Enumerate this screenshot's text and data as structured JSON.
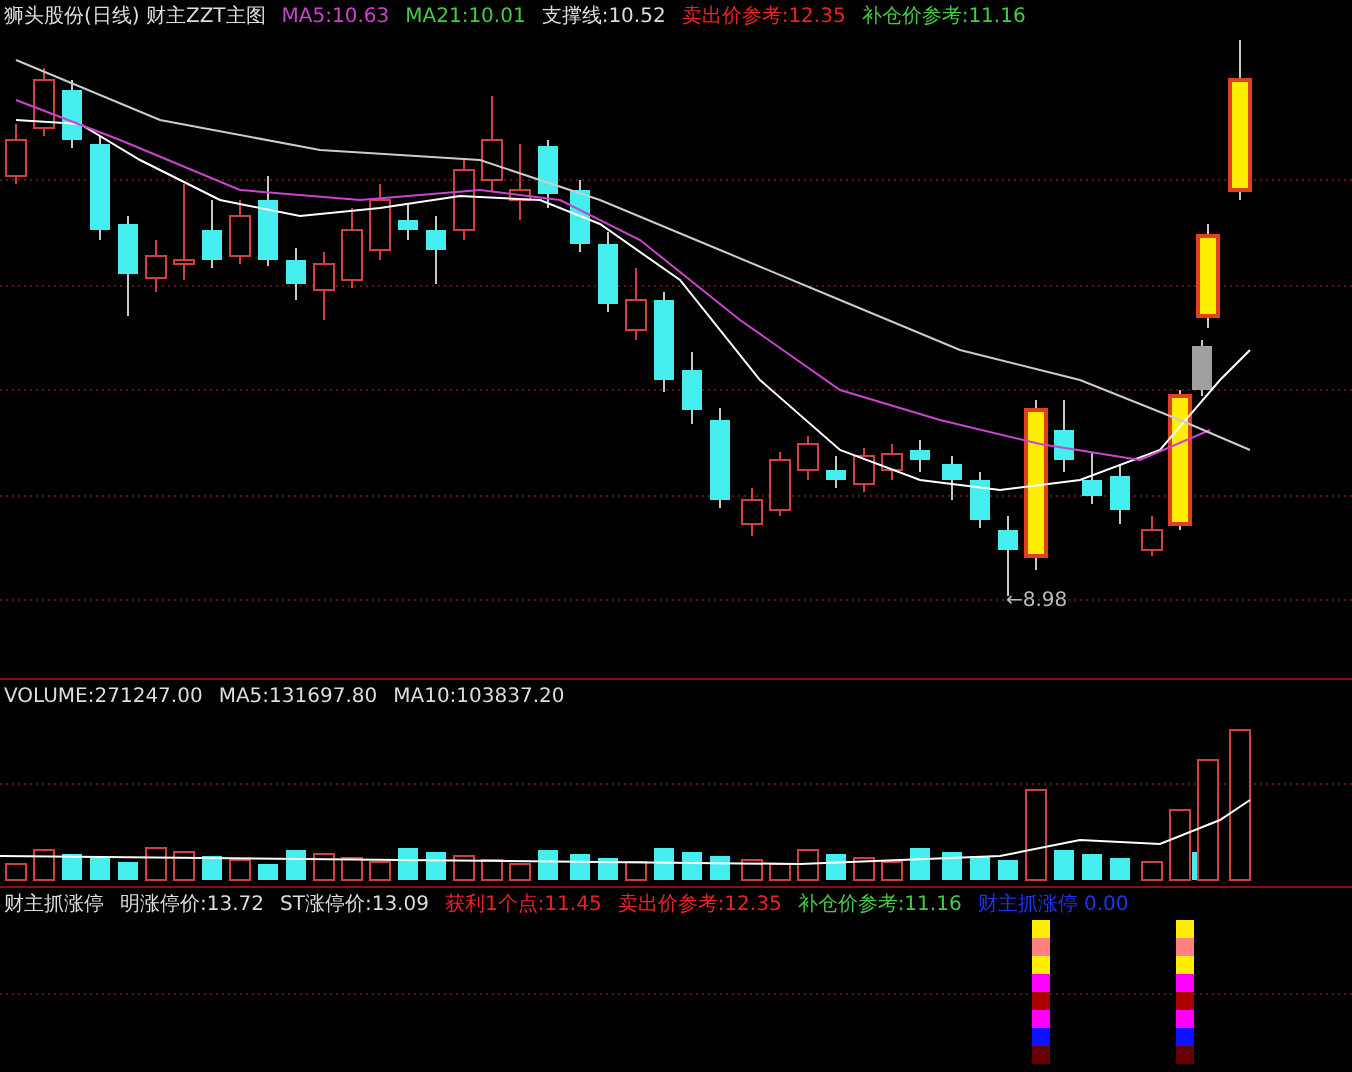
{
  "main_panel": {
    "title": "狮头股份(日线) 财主ZZT主图",
    "indicators": [
      {
        "label": "MA5:10.63",
        "color": "#cc44cc"
      },
      {
        "label": "MA21:10.01",
        "color": "#44cc44"
      },
      {
        "label": "支撑线:10.52",
        "color": "#dddddd"
      },
      {
        "label": "卖出价参考:12.35",
        "color": "#ee2222"
      },
      {
        "label": "补仓价参考:11.16",
        "color": "#44cc44"
      }
    ],
    "low_marker": "←8.98"
  },
  "volume_panel": {
    "labels": [
      {
        "label": "VOLUME:271247.00",
        "color": "#dddddd"
      },
      {
        "label": "MA5:131697.80",
        "color": "#dddddd"
      },
      {
        "label": "MA10:103837.20",
        "color": "#dddddd"
      }
    ]
  },
  "signal_panel": {
    "labels": [
      {
        "label": "财主抓涨停",
        "color": "#dddddd"
      },
      {
        "label": "明涨停价:13.72",
        "color": "#dddddd"
      },
      {
        "label": "ST涨停价:13.09",
        "color": "#dddddd"
      },
      {
        "label": "获利1个点:11.45",
        "color": "#ee2222"
      },
      {
        "label": "卖出价参考:12.35",
        "color": "#ee2222"
      },
      {
        "label": "补仓价参考:11.16",
        "color": "#44cc44"
      },
      {
        "label": "财主抓涨停 0.00",
        "color": "#2233ee"
      }
    ]
  }
}
